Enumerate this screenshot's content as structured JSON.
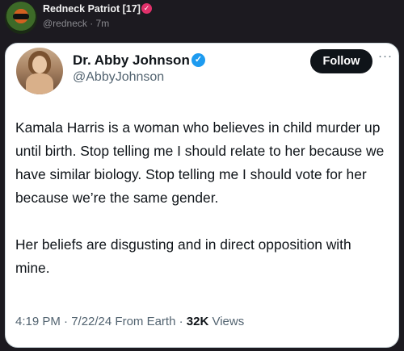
{
  "repost": {
    "author_name": "Redneck Patriot [17]",
    "handle_time": "@redneck · 7m",
    "badge_icon": "pink-verified-badge"
  },
  "embed": {
    "display_name": "Dr. Abby Johnson",
    "handle": "@AbbyJohnson",
    "follow_label": "Follow",
    "more_label": "···",
    "paragraphs": [
      "Kamala Harris is a woman who believes in child murder up until birth. Stop telling me I should relate to her because we have similar biology. Stop telling me I should vote for her because we’re the same gender.",
      "Her beliefs are disgusting and in direct opposition with mine."
    ],
    "time_date": "4:19 PM · 7/22/24 From Earth · ",
    "views_count": "32K",
    "views_label": " Views"
  },
  "colors": {
    "page_bg": "#1c1a20",
    "card_bg": "#ffffff",
    "verified_blue": "#1d9bf0",
    "verified_pink": "#e0306a",
    "text_primary": "#0f1419",
    "text_secondary": "#536471"
  }
}
